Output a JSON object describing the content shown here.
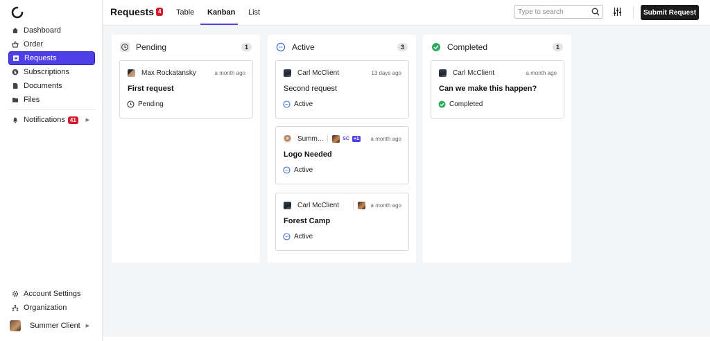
{
  "sidebar": {
    "logo_icon": "ring-logo-icon",
    "items": [
      {
        "label": "Dashboard",
        "icon": "home-icon"
      },
      {
        "label": "Order",
        "icon": "basket-icon"
      },
      {
        "label": "Requests",
        "icon": "list-icon",
        "active": true
      },
      {
        "label": "Subscriptions",
        "icon": "dollar-circle-icon"
      },
      {
        "label": "Documents",
        "icon": "document-icon"
      },
      {
        "label": "Files",
        "icon": "folder-icon"
      }
    ],
    "notifications": {
      "label": "Notifications",
      "badge": "41",
      "icon": "bell-icon"
    },
    "bottom_items": [
      {
        "label": "Account Settings",
        "icon": "gear-icon"
      },
      {
        "label": "Organization",
        "icon": "people-icon"
      }
    ],
    "user": {
      "name": "Summer Client"
    }
  },
  "header": {
    "title": "Requests",
    "badge": "4",
    "tabs": [
      {
        "label": "Table"
      },
      {
        "label": "Kanban",
        "active": true
      },
      {
        "label": "List"
      }
    ],
    "search_placeholder": "Type to search",
    "submit_label": "Submit Request"
  },
  "colors": {
    "accent": "#4f3fe6",
    "badge": "#d6182c",
    "completed": "#2bab5e",
    "active": "#3b6fd8",
    "board_bg": "#f4f5f7"
  },
  "columns": [
    {
      "title": "Pending",
      "count": "1",
      "icon": "clock-icon",
      "cards": [
        {
          "author": "Max Rockatansky",
          "time": "a month ago",
          "title": "First request",
          "title_bold": true,
          "status": "Pending"
        }
      ]
    },
    {
      "title": "Active",
      "count": "3",
      "icon": "dash-circle-icon",
      "cards": [
        {
          "author": "Carl McClient",
          "time": "13 days ago",
          "title": "Second request",
          "title_bold": false,
          "status": "Active"
        },
        {
          "author": "Summ...",
          "assignee_initials": "SC",
          "assignee_more": "+1",
          "time": "a month ago",
          "title": "Logo Needed",
          "title_bold": true,
          "status": "Active"
        },
        {
          "author": "Carl McClient",
          "time": "a month ago",
          "title": "Forest Camp",
          "title_bold": true,
          "status": "Active"
        }
      ]
    },
    {
      "title": "Completed",
      "count": "1",
      "icon": "check-circle-icon",
      "cards": [
        {
          "author": "Carl McClient",
          "time": "a month ago",
          "title": "Can we make this happen?",
          "title_bold": true,
          "status": "Completed"
        }
      ]
    }
  ]
}
